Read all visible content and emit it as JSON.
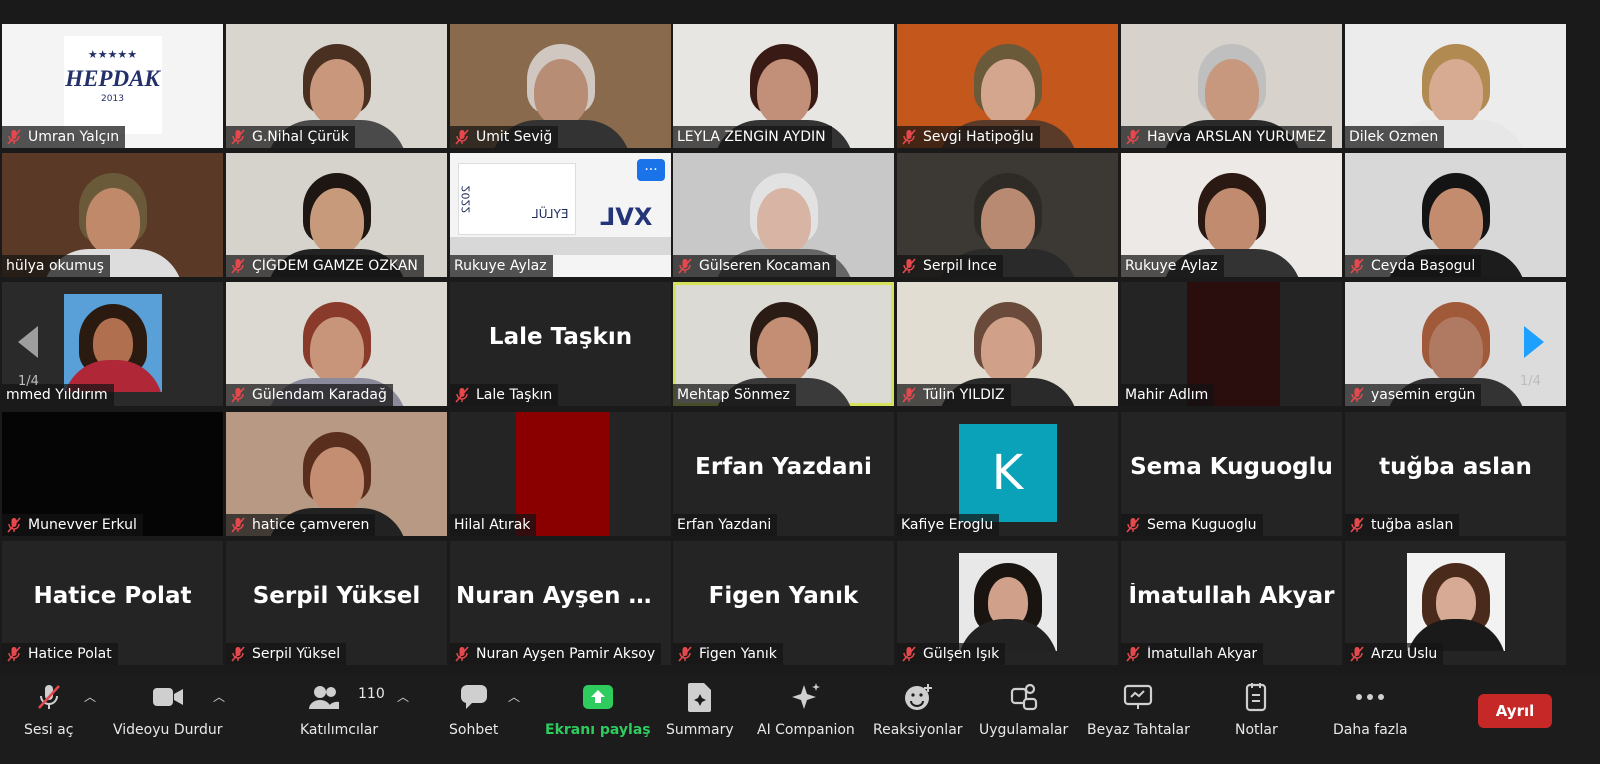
{
  "participants_page": "1/4",
  "tiles": [
    {
      "name": "Ümran Yalçın",
      "muted": true,
      "kind": "logo",
      "logo_text": "HEPDAK",
      "logo_year": "2013",
      "logo_stars": "★★★★★",
      "bg": "#f4f4f4"
    },
    {
      "name": "G.Nihal Çürük",
      "muted": true,
      "kind": "video",
      "bg": "#d9d6d0",
      "skin": "#c9977c",
      "hair": "#4a3020",
      "shirt": "#4a4a4a"
    },
    {
      "name": "Ümit Seviğ",
      "muted": true,
      "kind": "video",
      "bg": "#8a6a4c",
      "skin": "#b88d76",
      "hair": "#cfc7c0",
      "shirt": "#333"
    },
    {
      "name": "LEYLA ZENGİN AYDIN",
      "muted": false,
      "kind": "video",
      "bg": "#e8e6e3",
      "skin": "#c28f78",
      "hair": "#3a1a14",
      "shirt": "#333"
    },
    {
      "name": "Sevgi Hatipoğlu",
      "muted": true,
      "kind": "video",
      "bg": "#c4571c",
      "skin": "#d4a68d",
      "hair": "#6a5a3a",
      "shirt": "#5a3a28"
    },
    {
      "name": "Havva ARSLAN YÜRÜMEZ",
      "muted": true,
      "kind": "video",
      "bg": "#d8d2cc",
      "skin": "#c8987e",
      "hair": "#bfbfbf",
      "shirt": "#2a2a2a"
    },
    {
      "name": "Dilek Özmen",
      "muted": false,
      "kind": "video",
      "bg": "#ececec",
      "skin": "#d6ab92",
      "hair": "#b08a50",
      "shirt": "#e7e7e7"
    },
    {
      "name": "hülya okumuş",
      "muted": false,
      "kind": "video",
      "bg": "#5a3a26",
      "skin": "#c08a6a",
      "hair": "#6a5a3a",
      "shirt": "#ddd"
    },
    {
      "name": "ÇİĞDEM GAMZE ÖZKAN",
      "muted": true,
      "kind": "video",
      "bg": "#d6d2cc",
      "skin": "#c89a7c",
      "hair": "#1e1612",
      "shirt": "#222"
    },
    {
      "name": "Rukuye Aylaz",
      "muted": false,
      "kind": "calendar",
      "bg": "#f2f2f2",
      "calendar_text": "EYLÜL",
      "brand_text": "XVL",
      "year_text": "2022",
      "has_menu": true
    },
    {
      "name": "Gülseren Kocaman",
      "muted": true,
      "kind": "video",
      "bg": "#c8c8c8",
      "skin": "#d8b4a4",
      "hair": "#e2e2e2",
      "shirt": "#666"
    },
    {
      "name": "Serpil İnce",
      "muted": true,
      "kind": "video",
      "bg": "#3c3834",
      "skin": "#b88a72",
      "hair": "#2e2a26",
      "shirt": "#2a2a2a"
    },
    {
      "name": "Rukuye Aylaz",
      "muted": false,
      "kind": "video",
      "bg": "#ece9e6",
      "skin": "#c18b70",
      "hair": "#2a1812",
      "shirt": "#333"
    },
    {
      "name": "Ceyda Başogul",
      "muted": true,
      "kind": "video",
      "bg": "#d8d8d8",
      "skin": "#c48c6e",
      "hair": "#141414",
      "shirt": "#1c1c1c"
    },
    {
      "name": "mmed Yıldırım",
      "muted": false,
      "kind": "photo",
      "bg": "#2a2a2a",
      "photo_bg": "#5aa0d8",
      "skin": "#b07050",
      "hair": "#2a1a10",
      "shirt": "#b02838"
    },
    {
      "name": "Gülendam Karadağ",
      "muted": true,
      "kind": "video",
      "bg": "#dcd8d2",
      "skin": "#c9957a",
      "hair": "#8a3a2a",
      "shirt": "#8a8a9a"
    },
    {
      "name": "Lale Taşkın",
      "muted": true,
      "kind": "name",
      "bg": "#242424"
    },
    {
      "name": "Mehtap Sönmez",
      "muted": false,
      "kind": "video",
      "active": true,
      "bg": "#dcdad4",
      "skin": "#c48e74",
      "hair": "#2a1c14",
      "shirt": "#3a3a3a"
    },
    {
      "name": "Tülin YILDIZ",
      "muted": true,
      "kind": "video",
      "bg": "#e2ddd2",
      "skin": "#d0a188",
      "hair": "#6a4a3a",
      "shirt": "#2a2a2a"
    },
    {
      "name": "Mahir Adlım",
      "muted": false,
      "kind": "dark",
      "bg": "#242424",
      "inner": "#2a0d0d"
    },
    {
      "name": "yasemin ergün",
      "muted": true,
      "kind": "video",
      "bg": "#dcdcdc",
      "skin": "#b07a62",
      "hair": "#a05a3a",
      "shirt": "#333"
    },
    {
      "name": "Munevver Erkul",
      "muted": true,
      "kind": "dark",
      "bg": "#050505",
      "inner": "#050505"
    },
    {
      "name": "hatice çamveren",
      "muted": true,
      "kind": "video",
      "bg": "#b89a84",
      "skin": "#c48e72",
      "hair": "#5a2e1c",
      "shirt": "#222"
    },
    {
      "name": "Hilal Atırak",
      "muted": false,
      "kind": "dark",
      "bg": "#242424",
      "inner": "#8a0000"
    },
    {
      "name": "Erfan Yazdani",
      "muted": false,
      "kind": "name",
      "bg": "#242424"
    },
    {
      "name": "Kafiye Eroglu",
      "muted": false,
      "kind": "letter",
      "bg": "#242424",
      "letter": "K"
    },
    {
      "name": "Sema Kuguoglu",
      "muted": true,
      "kind": "name",
      "bg": "#242424"
    },
    {
      "name": "tuğba aslan",
      "muted": true,
      "kind": "name",
      "bg": "#242424"
    },
    {
      "name": "Hatice Polat",
      "muted": true,
      "kind": "name",
      "bg": "#242424"
    },
    {
      "name": "Serpil Yüksel",
      "muted": true,
      "kind": "name",
      "bg": "#242424"
    },
    {
      "name": "Nuran Ayşen Pamir Aksoy",
      "muted": true,
      "kind": "name",
      "big": "Nuran Ayşen Pa...",
      "bg": "#242424"
    },
    {
      "name": "Figen Yanık",
      "muted": true,
      "kind": "name",
      "bg": "#242424"
    },
    {
      "name": "Gülşen Işık",
      "muted": true,
      "kind": "photo",
      "bg": "#242424",
      "photo_bg": "#e8e8e8",
      "skin": "#d0a08a",
      "hair": "#1a1410",
      "shirt": "#222"
    },
    {
      "name": "İmatullah Akyar",
      "muted": true,
      "kind": "name",
      "bg": "#242424"
    },
    {
      "name": "Arzu Uslu",
      "muted": true,
      "kind": "photo",
      "bg": "#242424",
      "photo_bg": "#f2f2f2",
      "skin": "#d6aa94",
      "hair": "#4a2a1a",
      "shirt": "#1a1a1a"
    }
  ],
  "toolbar": {
    "mute_label": "Sesi aç",
    "video_label": "Videoyu Durdur",
    "participants_label": "Katılımcılar",
    "participants_count": "110",
    "chat_label": "Sohbet",
    "share_label": "Ekranı paylaş",
    "summary_label": "Summary",
    "ai_label": "AI Companion",
    "reactions_label": "Reaksiyonlar",
    "apps_label": "Uygulamalar",
    "whiteboard_label": "Beyaz Tahtalar",
    "notes_label": "Notlar",
    "more_label": "Daha fazla",
    "leave_label": "Ayrıl"
  },
  "colors": {
    "active_border": "#d4e35a",
    "mute_red": "#e5484d",
    "share_green": "#2ecc5e",
    "leave_red": "#c62828",
    "nav_blue": "#1ea0ff"
  }
}
